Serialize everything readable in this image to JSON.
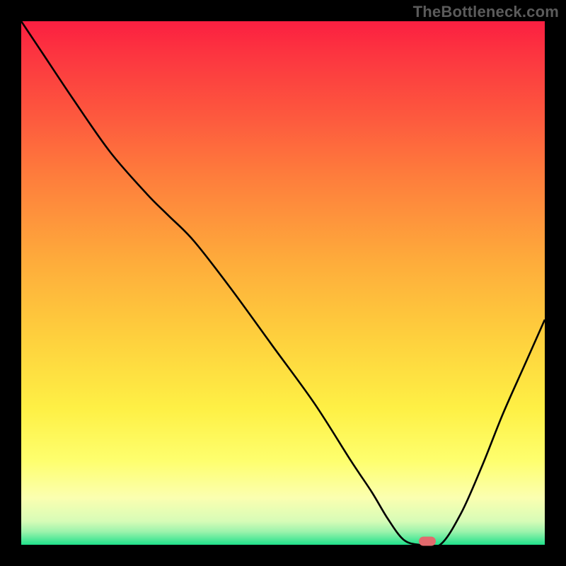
{
  "watermark": "TheBottleneck.com",
  "chart_data": {
    "type": "line",
    "title": "",
    "xlabel": "",
    "ylabel": "",
    "xlim": [
      0,
      100
    ],
    "ylim": [
      0,
      100
    ],
    "grid": false,
    "x": [
      0,
      4,
      10,
      17,
      24,
      28,
      33,
      40,
      48,
      56,
      63,
      67,
      70,
      73,
      76,
      80,
      84,
      88,
      92,
      96,
      100
    ],
    "values": [
      100,
      94,
      85,
      75,
      67,
      63,
      58,
      49,
      38,
      27,
      16,
      10,
      5,
      1,
      0,
      0,
      6,
      15,
      25,
      34,
      43
    ],
    "marker": {
      "x": 77.5,
      "y": 0
    }
  },
  "colors": {
    "curve": "#000000",
    "marker": "#e26a6d",
    "background": "#000000"
  }
}
